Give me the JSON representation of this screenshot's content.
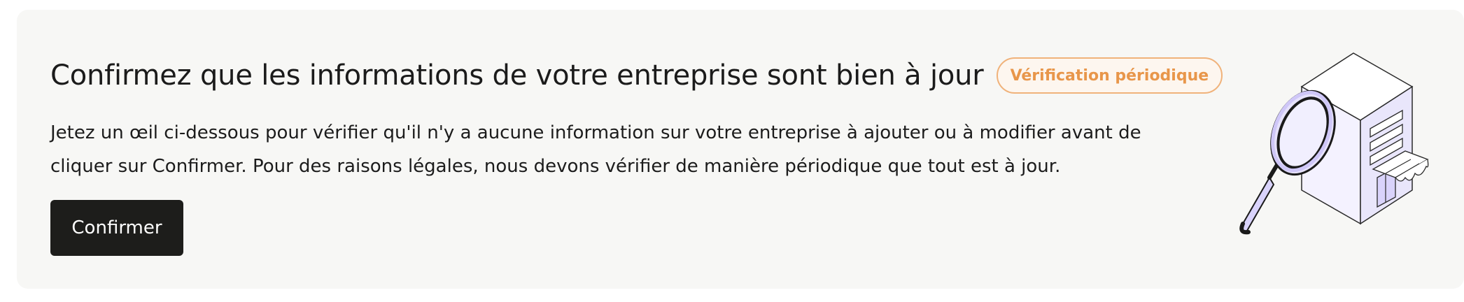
{
  "banner": {
    "title": "Confirmez que les informations de votre entreprise sont bien à jour",
    "badge_label": "Vérification périodique",
    "description": "Jetez un œil ci-dessous pour vérifier qu'il n'y a aucune information sur votre entreprise à ajouter ou à modifier avant de cliquer sur Confirmer. Pour des raisons légales, nous devons vérifier de manière périodique que tout est à jour.",
    "confirm_label": "Confirmer",
    "illustration_icon": "building-magnifier-icon"
  },
  "colors": {
    "card_background": "#f7f7f5",
    "badge_accent": "#e8964a",
    "button_background": "#1d1d1b",
    "illustration_fill": "#e9e6fb"
  }
}
